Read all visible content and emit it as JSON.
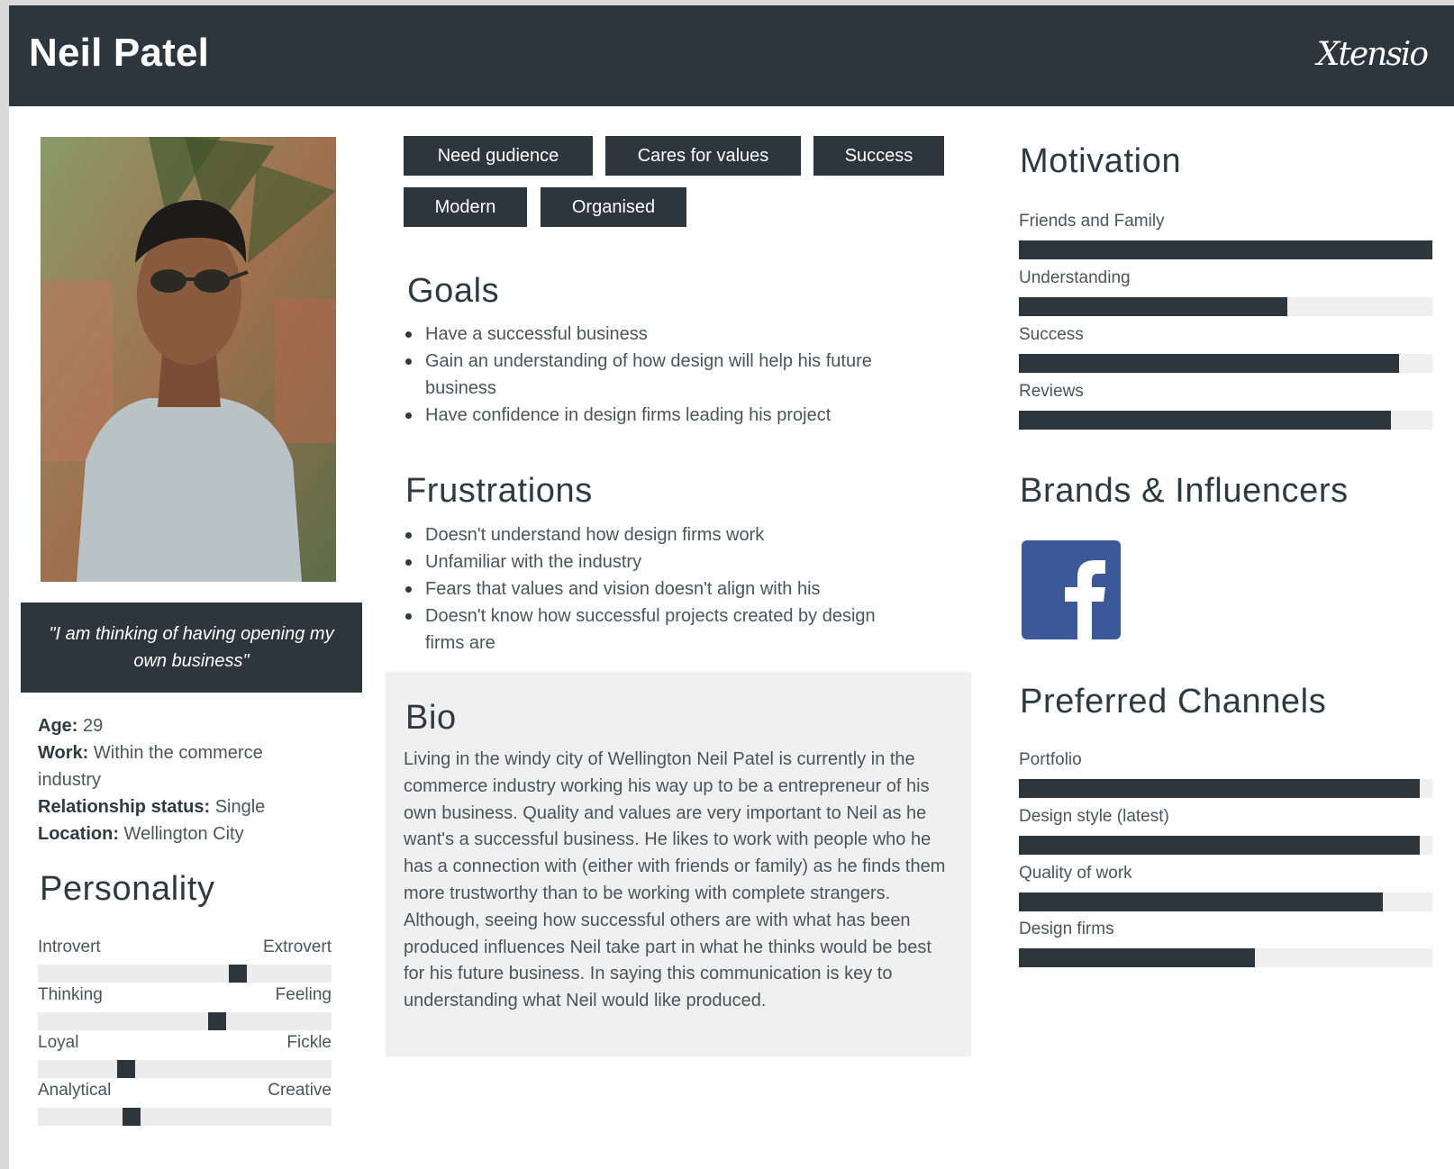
{
  "header": {
    "name": "Neil Patel",
    "logo": "Xtensio"
  },
  "quote": "\"I am thinking of having opening my own business\"",
  "facts": [
    {
      "label": "Age:",
      "value": " 29"
    },
    {
      "label": "Work:",
      "value": " Within the commerce industry"
    },
    {
      "label": "Relationship status:",
      "value": " Single"
    },
    {
      "label": "Location:",
      "value": " Wellington City"
    }
  ],
  "personality": {
    "title": "Personality",
    "traits": [
      {
        "left": "Introvert",
        "right": "Extrovert",
        "level": 0.68
      },
      {
        "left": "Thinking",
        "right": "Feeling",
        "level": 0.61
      },
      {
        "left": "Loyal",
        "right": "Fickle",
        "level": 0.3
      },
      {
        "left": "Analytical",
        "right": "Creative",
        "level": 0.32
      }
    ]
  },
  "tags": [
    "Need gudience",
    "Cares for values",
    "Success",
    "Modern",
    "Organised"
  ],
  "goals": {
    "title": "Goals",
    "items": [
      "Have a successful business",
      "Gain an understanding of how design will help his future business",
      "Have confidence in design firms leading his project"
    ]
  },
  "frustrations": {
    "title": "Frustrations",
    "items": [
      "Doesn't understand how design firms work",
      "Unfamiliar with the industry",
      "Fears that values and vision doesn't align with his",
      "Doesn't know how successful projects created by design firms are"
    ]
  },
  "bio": {
    "title": "Bio",
    "text": "Living in the windy city of Wellington Neil Patel is currently in the commerce industry working his way up to be a entrepreneur of his own business. Quality and values are very important to Neil as he want's a successful business. He likes to work with people who he has a connection with (either with friends or family) as he finds them more trustworthy than to be working with complete strangers. Although, seeing how successful others are with what has been produced influences Neil take part in what he thinks would be best for his future business. In saying this communication is key to understanding what Neil would like produced."
  },
  "motivation": {
    "title": "Motivation",
    "items": [
      {
        "label": "Friends and Family",
        "level": 1.0
      },
      {
        "label": "Understanding",
        "level": 0.65
      },
      {
        "label": "Success",
        "level": 0.92
      },
      {
        "label": "Reviews",
        "level": 0.9
      }
    ]
  },
  "brands": {
    "title": "Brands & Influencers",
    "icons": [
      "facebook-icon"
    ]
  },
  "channels": {
    "title": "Preferred Channels",
    "items": [
      {
        "label": "Portfolio",
        "level": 0.97
      },
      {
        "label": "Design style (latest)",
        "level": 0.97
      },
      {
        "label": "Quality of work",
        "level": 0.88
      },
      {
        "label": "Design firms",
        "level": 0.57
      }
    ]
  },
  "colors": {
    "dark": "#2d363c",
    "track": "#efefef",
    "facebook": "#3b5998",
    "bio_bg": "#f0f0f0"
  }
}
